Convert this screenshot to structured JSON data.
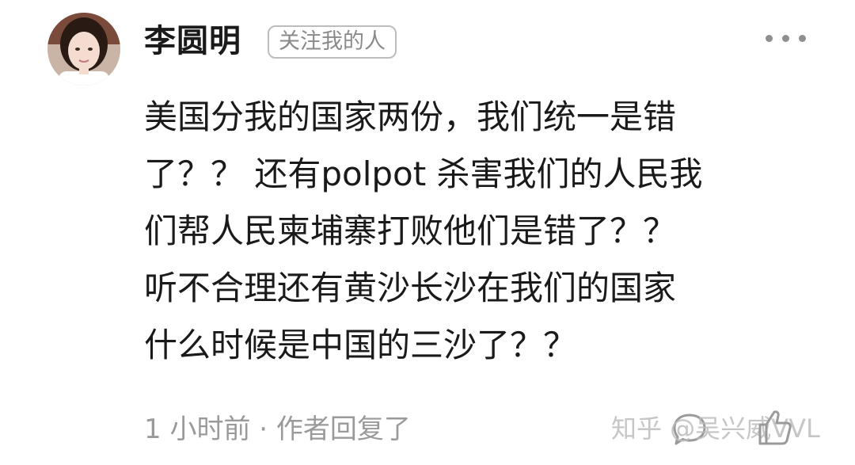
{
  "comment": {
    "author": "李圆明",
    "follow_badge": "关注我的人",
    "text_lines": [
      "美国分我的国家两份，我们统一是错",
      "了？？ 还有polpot 杀害我们的人民我",
      "们帮人民柬埔寨打败他们是错了？？",
      "听不合理还有黄沙长沙在我们的国家",
      "什么时候是中国的三沙了？？"
    ],
    "meta": "1 小时前 · 作者回复了"
  },
  "watermark": "知乎 @吴兴威VVL",
  "icons": {
    "more": "more-dots-icon",
    "reply": "comment-bubble-icon",
    "like": "thumbs-up-icon"
  },
  "colors": {
    "text": "#1a1a1a",
    "muted": "#9a9a9a",
    "badge_border": "#bdbdbd"
  }
}
